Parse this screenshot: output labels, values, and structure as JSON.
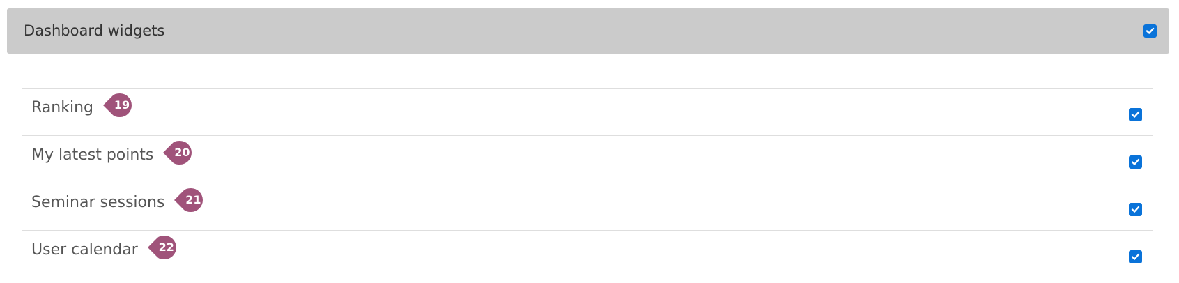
{
  "header": {
    "title": "Dashboard widgets",
    "checked": true
  },
  "widgets": [
    {
      "label": "Ranking",
      "badge": "19",
      "checked": true
    },
    {
      "label": "My latest points",
      "badge": "20",
      "checked": true
    },
    {
      "label": "Seminar sessions",
      "badge": "21",
      "checked": true
    },
    {
      "label": "User calendar",
      "badge": "22",
      "checked": true
    }
  ],
  "colors": {
    "header_bg": "#cbcbcb",
    "checkbox": "#0a73d9",
    "badge": "#a0537a"
  }
}
